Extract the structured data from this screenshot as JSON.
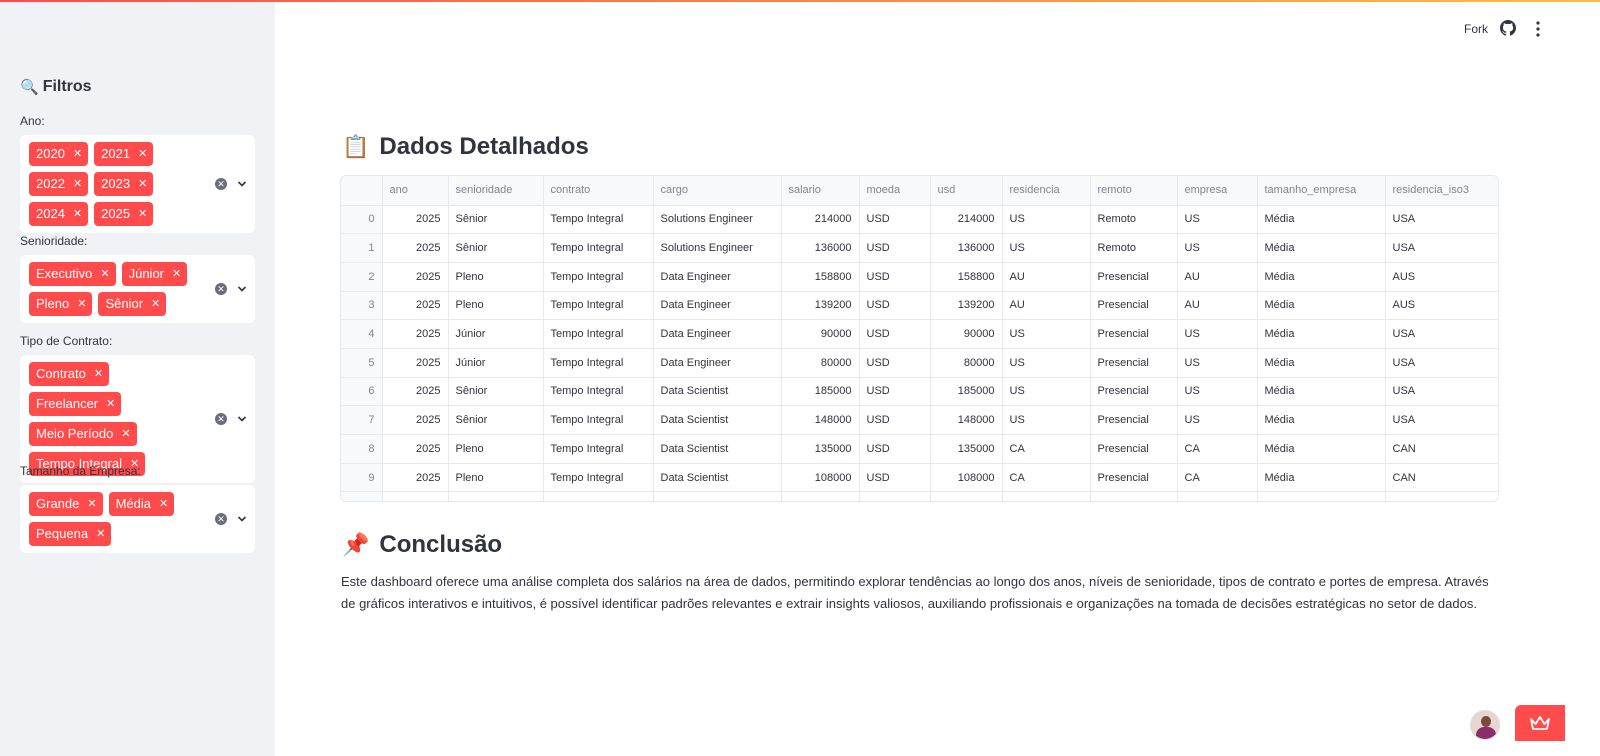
{
  "header": {
    "fork_label": "Fork"
  },
  "sidebar": {
    "title": "Filtros",
    "filters": [
      {
        "label": "Ano:",
        "tags": [
          "2020",
          "2021",
          "2022",
          "2023",
          "2024",
          "2025"
        ]
      },
      {
        "label": "Senioridade:",
        "tags": [
          "Executivo",
          "Júnior",
          "Pleno",
          "Sênior"
        ]
      },
      {
        "label": "Tipo de Contrato:",
        "tags": [
          "Contrato",
          "Freelancer",
          "Meio Período",
          "Tempo Integral"
        ]
      },
      {
        "label": "Tamanho da Empresa:",
        "tags": [
          "Grande",
          "Média",
          "Pequena"
        ]
      }
    ]
  },
  "main": {
    "table_heading": "Dados Detalhados",
    "table_emoji": "📋",
    "columns": [
      "",
      "ano",
      "senioridade",
      "contrato",
      "cargo",
      "salario",
      "moeda",
      "usd",
      "residencia",
      "remoto",
      "empresa",
      "tamanho_empresa",
      "residencia_iso3"
    ],
    "rows": [
      [
        "0",
        "2025",
        "Sênior",
        "Tempo Integral",
        "Solutions Engineer",
        "214000",
        "USD",
        "214000",
        "US",
        "Remoto",
        "US",
        "Média",
        "USA"
      ],
      [
        "1",
        "2025",
        "Sênior",
        "Tempo Integral",
        "Solutions Engineer",
        "136000",
        "USD",
        "136000",
        "US",
        "Remoto",
        "US",
        "Média",
        "USA"
      ],
      [
        "2",
        "2025",
        "Pleno",
        "Tempo Integral",
        "Data Engineer",
        "158800",
        "USD",
        "158800",
        "AU",
        "Presencial",
        "AU",
        "Média",
        "AUS"
      ],
      [
        "3",
        "2025",
        "Pleno",
        "Tempo Integral",
        "Data Engineer",
        "139200",
        "USD",
        "139200",
        "AU",
        "Presencial",
        "AU",
        "Média",
        "AUS"
      ],
      [
        "4",
        "2025",
        "Júnior",
        "Tempo Integral",
        "Data Engineer",
        "90000",
        "USD",
        "90000",
        "US",
        "Presencial",
        "US",
        "Média",
        "USA"
      ],
      [
        "5",
        "2025",
        "Júnior",
        "Tempo Integral",
        "Data Engineer",
        "80000",
        "USD",
        "80000",
        "US",
        "Presencial",
        "US",
        "Média",
        "USA"
      ],
      [
        "6",
        "2025",
        "Sênior",
        "Tempo Integral",
        "Data Scientist",
        "185000",
        "USD",
        "185000",
        "US",
        "Presencial",
        "US",
        "Média",
        "USA"
      ],
      [
        "7",
        "2025",
        "Sênior",
        "Tempo Integral",
        "Data Scientist",
        "148000",
        "USD",
        "148000",
        "US",
        "Presencial",
        "US",
        "Média",
        "USA"
      ],
      [
        "8",
        "2025",
        "Pleno",
        "Tempo Integral",
        "Data Scientist",
        "135000",
        "USD",
        "135000",
        "CA",
        "Presencial",
        "CA",
        "Média",
        "CAN"
      ],
      [
        "9",
        "2025",
        "Pleno",
        "Tempo Integral",
        "Data Scientist",
        "108000",
        "USD",
        "108000",
        "CA",
        "Presencial",
        "CA",
        "Média",
        "CAN"
      ]
    ],
    "conclusion_heading": "Conclusão",
    "conclusion_emoji": "📌",
    "conclusion_text": "Este dashboard oferece uma análise completa dos salários na área de dados, permitindo explorar tendências ao longo dos anos, níveis de senioridade, tipos de contrato e portes de empresa. Através de gráficos interativos e intuitivos, é possível identificar padrões relevantes e extrair insights valiosos, auxiliando profissionais e organizações na tomada de decisões estratégicas no setor de dados."
  },
  "colors": {
    "accent": "#ff4b4b",
    "sidebar_bg": "#f0f2f6",
    "text": "#31333f"
  },
  "icons": [
    "search-icon",
    "github-icon",
    "more-vert-icon",
    "clipboard-icon",
    "pin-icon",
    "clear-icon",
    "chevron-down-icon",
    "crown-icon"
  ]
}
